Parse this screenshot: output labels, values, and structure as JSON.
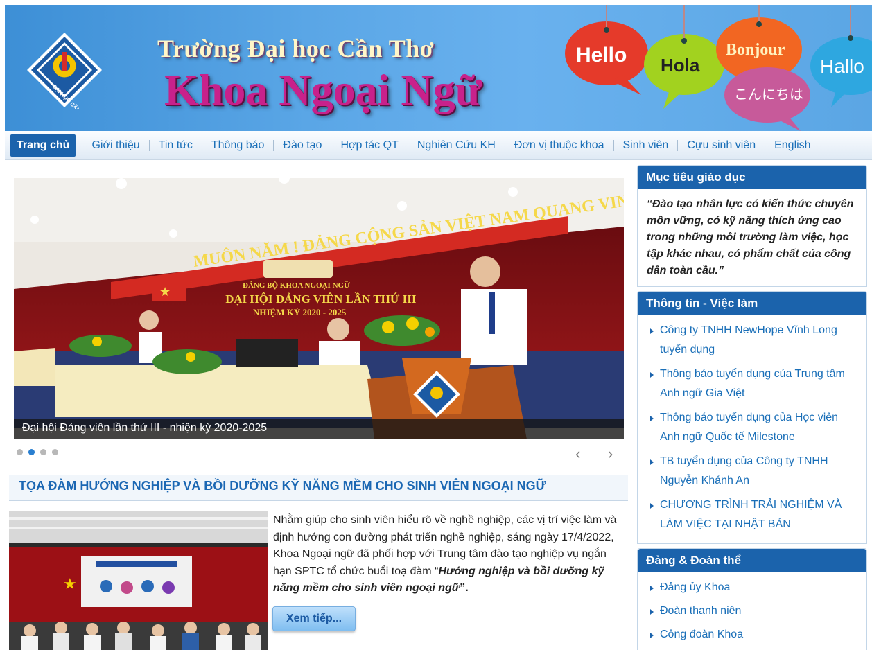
{
  "header": {
    "logo_text": "ĐẠI HỌC CẦN THƠ",
    "university": "Trường Đại học Cần Thơ",
    "faculty": "Khoa Ngoại Ngữ",
    "greetings": [
      "Hello",
      "Hola",
      "Bonjour",
      "こんにちは",
      "Hallo"
    ]
  },
  "nav": {
    "items": [
      "Trang chủ",
      "Giới thiệu",
      "Tin tức",
      "Thông báo",
      "Đào tạo",
      "Hợp tác QT",
      "Nghiên Cứu KH",
      "Đơn vị thuộc khoa",
      "Sinh viên",
      "Cựu sinh viên",
      "English"
    ],
    "active": "Trang chủ"
  },
  "slider": {
    "caption": "Đại hội Đảng viên lần thứ III - nhiện kỳ 2020-2025",
    "banner_text": "MUÔN NĂM ! ĐẢNG CỘNG SẢN VIỆT NAM QUANG VINH MUÔN NĂM !",
    "stage_text_1": "ĐẢNG BỘ KHOA NGOẠI NGỮ",
    "stage_text_2": "ĐẠI HỘI ĐẢNG VIÊN LẦN THỨ III",
    "stage_text_3": "NHIỆM KỲ 2020 - 2025",
    "slide_count": 4,
    "current_slide": 2,
    "prev_icon": "‹",
    "next_icon": "›"
  },
  "article": {
    "title": "TỌA ĐÀM HƯỚNG NGHIỆP VÀ BỒI DƯỠNG KỸ NĂNG MỀM CHO SINH VIÊN NGOẠI NGỮ",
    "body_intro": "Nhằm giúp cho sinh viên hiểu rõ về nghề nghiệp, các vị trí việc làm và định hướng con đường phát triển nghề nghiệp, sáng ngày 17/4/2022, Khoa Ngoại ngữ đã phối hợp với Trung tâm đào tạo nghiệp vụ ngắn hạn SPTC tổ chức buổi toạ đàm “",
    "body_emphasis": "Hướng nghiệp và bồi dưỡng kỹ năng mềm cho sinh viên ngoại ngữ",
    "body_end": "”.",
    "more_button": "Xem tiếp..."
  },
  "sidebar": {
    "goals": {
      "title": "Mục tiêu giáo dục",
      "quote": "“Đào tạo nhân lực có kiến thức chuyên môn vững, có kỹ năng thích ứng cao trong những môi trường làm việc, học tập khác nhau, có phẩm chất của công dân toàn cầu.”"
    },
    "jobs": {
      "title": "Thông tin - Việc làm",
      "items": [
        "Công ty TNHH NewHope Vĩnh Long tuyển dụng",
        "Thông báo tuyển dụng của Trung tâm Anh ngữ Gia Việt",
        "Thông báo tuyển dụng của Học viên Anh ngữ Quốc tế Milestone",
        "TB tuyển dụng của Công ty TNHH Nguyễn Khánh An",
        "CHƯƠNG TRÌNH TRẢI NGHIỆM VÀ LÀM VIỆC TẠI NHẬT BẢN"
      ]
    },
    "party": {
      "title": "Đảng & Đoàn thể",
      "items": [
        "Đảng ủy Khoa",
        "Đoàn thanh niên",
        "Công đoàn Khoa"
      ]
    }
  },
  "colors": {
    "primary": "#1b63ac",
    "link": "#1a6fb8",
    "faculty_title": "#c8218b"
  }
}
